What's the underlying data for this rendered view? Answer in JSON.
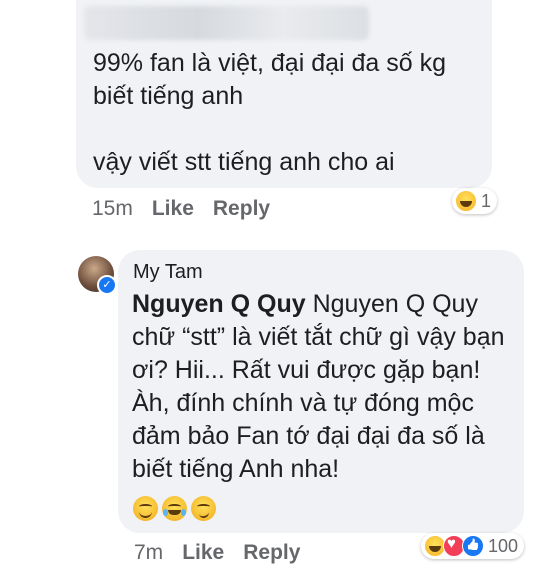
{
  "comment1": {
    "text": "99% fan là việt, đại đại đa số kg\nbiết tiếng anh\n\nvậy viết stt tiếng anh cho ai",
    "time": "15m",
    "like_label": "Like",
    "reply_label": "Reply",
    "reactions": {
      "icons": [
        "haha-reaction-icon"
      ],
      "count": "1"
    }
  },
  "comment2": {
    "author": "My Tam",
    "mention": "Nguyen Q Quy",
    "text": " Nguyen Q Quy chữ “stt” là viết tắt chữ gì vậy bạn ơi? Hii... Rất vui được gặp bạn! Àh, đính chính và tự đóng mộc đảm bảo Fan tớ đại đại đa số là biết tiếng Anh nha!",
    "emojis": [
      "smiling-face-icon",
      "tears-of-joy-icon",
      "woozy-face-icon"
    ],
    "time": "7m",
    "like_label": "Like",
    "reply_label": "Reply",
    "reactions": {
      "icons": [
        "haha-reaction-icon",
        "love-reaction-icon",
        "like-reaction-icon"
      ],
      "count": "100"
    }
  }
}
